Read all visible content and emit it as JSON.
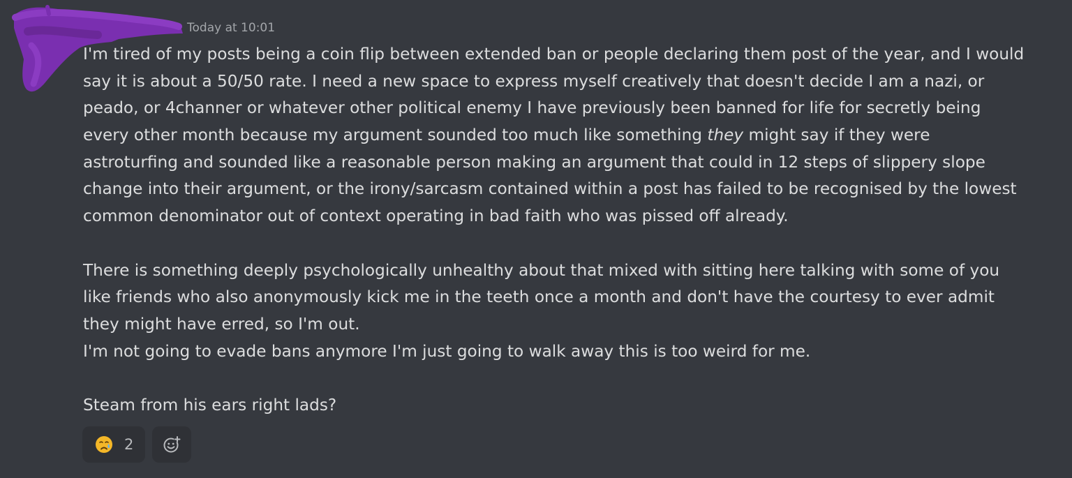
{
  "message": {
    "timestamp": "Today at 10:01",
    "paragraph1": {
      "line1": "I'm tired of my posts being a coin flip between extended ban or people declaring them post of the year, and I would",
      "line2": "say it is about a 50/50 rate. I need a new space to express myself creatively that doesn't decide I am a nazi, or",
      "line3": "peado, or 4channer or whatever other political enemy I have previously been banned for life for secretly being",
      "line4_before": "every other month because my argument sounded too much like something ",
      "line4_italic": "they",
      "line4_after": " might say if they were",
      "line5": "astroturfing and sounded like a reasonable person making an argument that could in 12 steps of slippery slope",
      "line6": "change into their argument, or the irony/sarcasm contained within a post has failed to be recognised by the lowest",
      "line7": "common denominator out of context operating in bad faith who was pissed off already."
    },
    "paragraph2": {
      "line1": "There is something deeply psychologically unhealthy about that mixed with sitting here talking with some of you",
      "line2": "like friends who also anonymously kick me in the teeth once a month and don't have the courtesy to ever admit",
      "line3": "they might have erred, so I'm out.",
      "line4": "I'm not going to evade bans anymore I'm just going to walk away this is too weird for me."
    },
    "paragraph3": {
      "line1": "Steam from his ears right lads?"
    }
  },
  "reactions": [
    {
      "emoji": "crying-face-emoji",
      "count": "2"
    }
  ],
  "add_reaction": {
    "icon": "add-reaction-icon"
  },
  "colors": {
    "background": "#36393f",
    "text": "#dcddde",
    "timestamp": "#a3a6aa",
    "reaction_bg": "#2f3136",
    "redaction": "#7a2fb0"
  }
}
